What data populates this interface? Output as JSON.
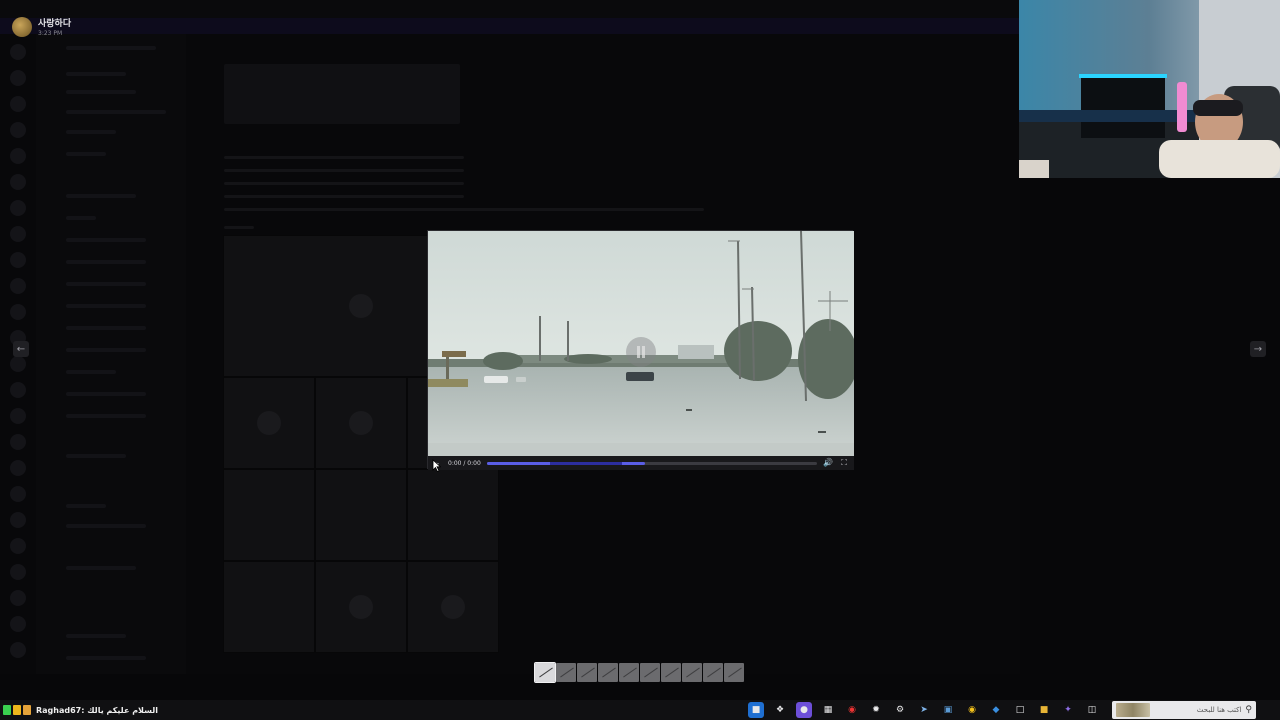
{
  "author": {
    "name": "사랑하다",
    "time": "3:23 PM"
  },
  "player": {
    "time": "0:00 / 0:00",
    "progress": 0.48
  },
  "icons": {
    "prev": "arrow-left-icon",
    "next": "arrow-right-icon",
    "play": "play-icon",
    "volume": "volume-icon",
    "fullscreen": "fullscreen-icon",
    "search": "search-icon"
  },
  "thumbnails": {
    "count": 10,
    "active_index": 0
  },
  "taskbar": {
    "chat_text": "Raghad67: السلام عليكم يالك",
    "search_placeholder": "اكتب هنا للبحث"
  },
  "colors": {
    "accent": "#5a5ee6",
    "banner": "#0d0b1c"
  }
}
